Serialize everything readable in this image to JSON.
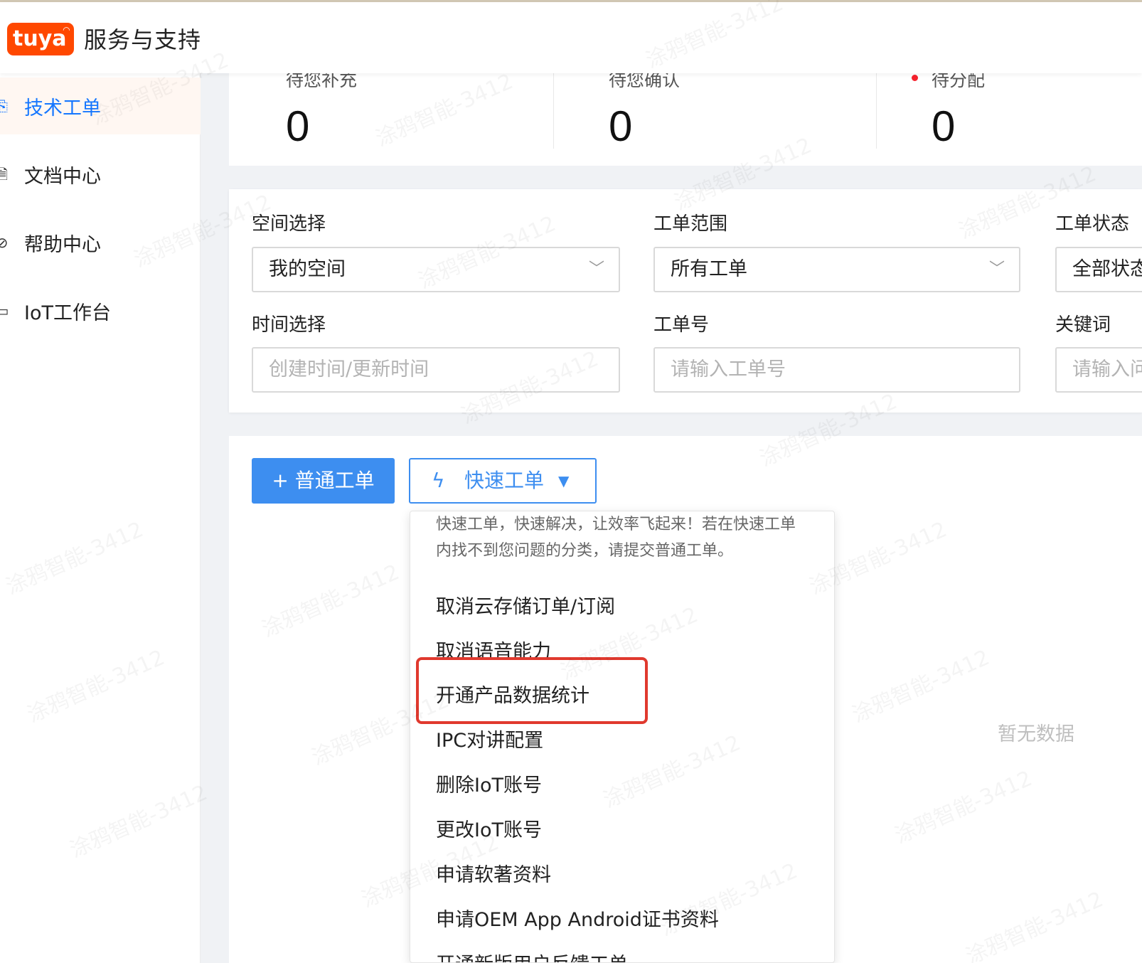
{
  "header": {
    "logo_text": "tuya",
    "title": "服务与支持"
  },
  "sidebar": {
    "items": [
      {
        "label": "技术工单",
        "icon": "ticket-icon",
        "active": true
      },
      {
        "label": "文档中心",
        "icon": "document-icon",
        "active": false
      },
      {
        "label": "帮助中心",
        "icon": "help-icon",
        "active": false
      },
      {
        "label": "IoT工作台",
        "icon": "workbench-icon",
        "active": false
      }
    ]
  },
  "stats": [
    {
      "label": "待您补充",
      "value": "0",
      "alert": false
    },
    {
      "label": "待您确认",
      "value": "0",
      "alert": false
    },
    {
      "label": "待分配",
      "value": "0",
      "alert": true
    }
  ],
  "filters": {
    "space": {
      "label": "空间选择",
      "value": "我的空间"
    },
    "scope": {
      "label": "工单范围",
      "value": "所有工单"
    },
    "status": {
      "label": "工单状态",
      "value": "全部状态"
    },
    "time": {
      "label": "时间选择",
      "placeholder": "创建时间/更新时间"
    },
    "ticket_no": {
      "label": "工单号",
      "placeholder": "请输入工单号"
    },
    "keyword": {
      "label": "关键词",
      "placeholder": "请输入问题"
    }
  },
  "actions": {
    "normal_ticket": "+ 普通工单",
    "quick_ticket": "快速工单"
  },
  "quick_menu": {
    "description": "快速工单，快速解决，让效率飞起来！若在快速工单内找不到您问题的分类，请提交普通工单。",
    "items": [
      "取消云存储订单/订阅",
      "取消语音能力",
      "开通产品数据统计",
      "IPC对讲配置",
      "删除IoT账号",
      "更改IoT账号",
      "申请软著资料",
      "申请OEM App Android证书资料",
      "开通新版用户反馈工单"
    ],
    "highlighted_index": 2
  },
  "empty_text": "暂无数据",
  "watermark_text": "涂鸦智能-3412",
  "colors": {
    "primary": "#3d8ef0",
    "brand": "#ff4800",
    "highlight_border": "#e0392e"
  }
}
